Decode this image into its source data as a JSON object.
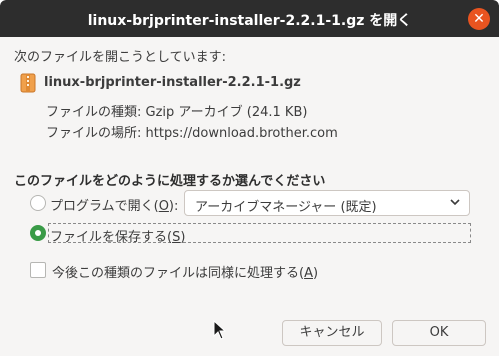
{
  "window": {
    "title": "linux-brjprinter-installer-2.2.1-1.gz を開く"
  },
  "content": {
    "intro": "次のファイルを開こうとしています:",
    "filename": "linux-brjprinter-installer-2.2.1-1.gz",
    "file_type_label": "ファイルの種類:",
    "file_type_value": "Gzip アーカイブ (24.1 KB)",
    "file_location_label": "ファイルの場所:",
    "file_location_value": "https://download.brother.com"
  },
  "options": {
    "heading": "このファイルをどのように処理するか選んでください",
    "open_with_label_pre": "プログラムで開く(",
    "open_with_mnemonic": "O",
    "open_with_label_post": "):",
    "open_with_selected": false,
    "app_select_value": "アーカイブマネージャー (既定)",
    "save_label_pre": "ファイルを保存する(",
    "save_mnemonic": "S",
    "save_label_post": ")",
    "save_selected": true,
    "remember_label_pre": "今後この種類のファイルは同様に処理する(",
    "remember_mnemonic": "A",
    "remember_label_post": ")",
    "remember_checked": false
  },
  "buttons": {
    "cancel": "キャンセル",
    "ok": "OK"
  },
  "icons": {
    "close": "close-icon",
    "file": "archive-file-icon",
    "chevron": "chevron-down-icon",
    "cursor": "mouse-pointer-icon"
  },
  "colors": {
    "titlebar": "#2d2d2d",
    "close_button": "#e95420",
    "radio_checked": "#3a9b47"
  }
}
